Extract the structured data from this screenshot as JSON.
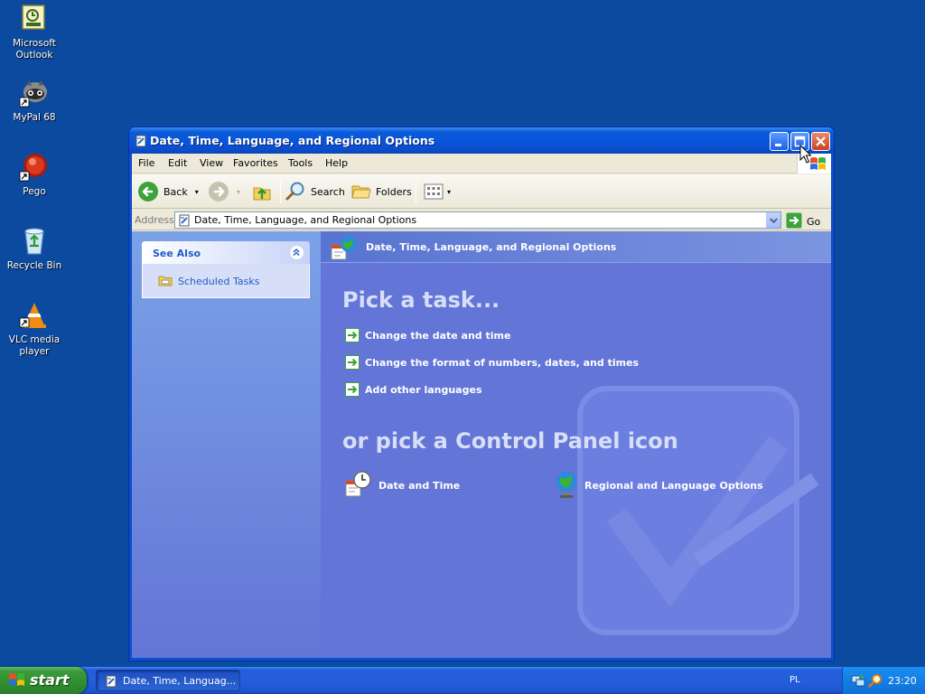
{
  "desktop": {
    "icons": [
      {
        "label_1": "Microsoft",
        "label_2": "Outlook",
        "icon": "outlook-icon"
      },
      {
        "label_1": "MyPal 68",
        "label_2": "",
        "icon": "mypal-icon"
      },
      {
        "label_1": "Pego",
        "label_2": "",
        "icon": "pego-icon"
      },
      {
        "label_1": "Recycle Bin",
        "label_2": "",
        "icon": "recycle-bin-icon"
      },
      {
        "label_1": "VLC media",
        "label_2": "player",
        "icon": "vlc-icon"
      }
    ]
  },
  "window": {
    "title": "Date, Time, Language, and Regional Options",
    "menu": [
      "File",
      "Edit",
      "View",
      "Favorites",
      "Tools",
      "Help"
    ],
    "toolbar": {
      "back": "Back",
      "search": "Search",
      "folders": "Folders"
    },
    "address": {
      "label": "Address",
      "value": "Date, Time, Language, and Regional Options",
      "go": "Go"
    },
    "see_also": {
      "title": "See Also",
      "items": [
        "Scheduled Tasks"
      ]
    },
    "main": {
      "header": "Date, Time, Language, and Regional Options",
      "pick_task_heading": "Pick a task...",
      "tasks": [
        "Change the date and time",
        "Change the format of numbers, dates, and times",
        "Add other languages"
      ],
      "pick_icon_heading": "or pick a Control Panel icon",
      "cp_icons": [
        "Date and Time",
        "Regional and Language Options"
      ]
    }
  },
  "taskbar": {
    "start": "start",
    "task_button": "Date, Time, Languag...",
    "language": "PL",
    "clock": "23:20"
  },
  "colors": {
    "desktop": "#0c4aa0",
    "task_pane": "#6375d6",
    "titlebar": "#0855dd",
    "start_green": "#3b9c3b"
  }
}
